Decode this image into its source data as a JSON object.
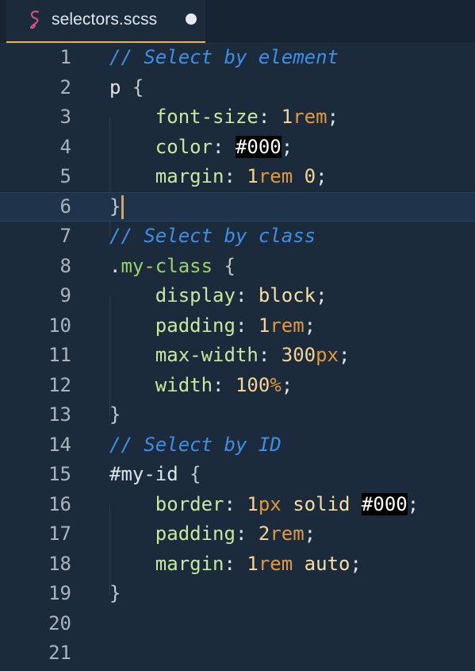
{
  "tab": {
    "filename": "selectors.scss",
    "icon": "sass-icon",
    "modified": true
  },
  "editor": {
    "active_line": 6,
    "lines": [
      {
        "n": "1",
        "tokens": [
          {
            "t": "// Select by element",
            "c": "c-comment"
          }
        ]
      },
      {
        "n": "2",
        "tokens": [
          {
            "t": "p",
            "c": "c-sel"
          },
          {
            "t": " {",
            "c": "c-brace"
          }
        ]
      },
      {
        "n": "3",
        "tokens": [
          {
            "t": "    font-size",
            "c": "c-prop"
          },
          {
            "t": ": ",
            "c": "c-punc"
          },
          {
            "t": "1",
            "c": "c-num"
          },
          {
            "t": "rem",
            "c": "c-unit"
          },
          {
            "t": ";",
            "c": "c-punc"
          }
        ]
      },
      {
        "n": "4",
        "tokens": [
          {
            "t": "    color",
            "c": "c-prop"
          },
          {
            "t": ": ",
            "c": "c-punc"
          },
          {
            "t": "#000",
            "c": "c-hex"
          },
          {
            "t": ";",
            "c": "c-punc"
          }
        ]
      },
      {
        "n": "5",
        "tokens": [
          {
            "t": "    margin",
            "c": "c-prop"
          },
          {
            "t": ": ",
            "c": "c-punc"
          },
          {
            "t": "1",
            "c": "c-num"
          },
          {
            "t": "rem",
            "c": "c-unit"
          },
          {
            "t": " 0",
            "c": "c-num"
          },
          {
            "t": ";",
            "c": "c-punc"
          }
        ]
      },
      {
        "n": "6",
        "tokens": [
          {
            "t": "}",
            "c": "c-brace"
          }
        ]
      },
      {
        "n": "7",
        "tokens": [
          {
            "t": "// Select by class",
            "c": "c-comment"
          }
        ]
      },
      {
        "n": "8",
        "tokens": [
          {
            "t": ".",
            "c": "c-punc"
          },
          {
            "t": "my-class",
            "c": "c-class"
          },
          {
            "t": " {",
            "c": "c-brace"
          }
        ]
      },
      {
        "n": "9",
        "tokens": [
          {
            "t": "    display",
            "c": "c-prop"
          },
          {
            "t": ": ",
            "c": "c-punc"
          },
          {
            "t": "block",
            "c": "c-val"
          },
          {
            "t": ";",
            "c": "c-punc"
          }
        ]
      },
      {
        "n": "10",
        "tokens": [
          {
            "t": "    padding",
            "c": "c-prop"
          },
          {
            "t": ": ",
            "c": "c-punc"
          },
          {
            "t": "1",
            "c": "c-num"
          },
          {
            "t": "rem",
            "c": "c-unit"
          },
          {
            "t": ";",
            "c": "c-punc"
          }
        ]
      },
      {
        "n": "11",
        "tokens": [
          {
            "t": "    max-width",
            "c": "c-prop"
          },
          {
            "t": ": ",
            "c": "c-punc"
          },
          {
            "t": "300",
            "c": "c-num"
          },
          {
            "t": "px",
            "c": "c-unit"
          },
          {
            "t": ";",
            "c": "c-punc"
          }
        ]
      },
      {
        "n": "12",
        "tokens": [
          {
            "t": "    width",
            "c": "c-prop"
          },
          {
            "t": ": ",
            "c": "c-punc"
          },
          {
            "t": "100",
            "c": "c-num"
          },
          {
            "t": "%",
            "c": "c-unit"
          },
          {
            "t": ";",
            "c": "c-punc"
          }
        ]
      },
      {
        "n": "13",
        "tokens": [
          {
            "t": "}",
            "c": "c-brace"
          }
        ]
      },
      {
        "n": "14",
        "tokens": [
          {
            "t": "// Select by ID",
            "c": "c-comment"
          }
        ]
      },
      {
        "n": "15",
        "tokens": [
          {
            "t": "#my-id",
            "c": "c-sel"
          },
          {
            "t": " {",
            "c": "c-brace"
          }
        ]
      },
      {
        "n": "16",
        "tokens": [
          {
            "t": "    border",
            "c": "c-prop"
          },
          {
            "t": ": ",
            "c": "c-punc"
          },
          {
            "t": "1",
            "c": "c-num"
          },
          {
            "t": "px",
            "c": "c-unit"
          },
          {
            "t": " solid ",
            "c": "c-val"
          },
          {
            "t": "#000",
            "c": "c-hex"
          },
          {
            "t": ";",
            "c": "c-punc"
          }
        ]
      },
      {
        "n": "17",
        "tokens": [
          {
            "t": "    padding",
            "c": "c-prop"
          },
          {
            "t": ": ",
            "c": "c-punc"
          },
          {
            "t": "2",
            "c": "c-num"
          },
          {
            "t": "rem",
            "c": "c-unit"
          },
          {
            "t": ";",
            "c": "c-punc"
          }
        ]
      },
      {
        "n": "18",
        "tokens": [
          {
            "t": "    margin",
            "c": "c-prop"
          },
          {
            "t": ": ",
            "c": "c-punc"
          },
          {
            "t": "1",
            "c": "c-num"
          },
          {
            "t": "rem",
            "c": "c-unit"
          },
          {
            "t": " auto",
            "c": "c-val"
          },
          {
            "t": ";",
            "c": "c-punc"
          }
        ]
      },
      {
        "n": "19",
        "tokens": [
          {
            "t": "}",
            "c": "c-brace"
          }
        ]
      },
      {
        "n": "20",
        "tokens": []
      },
      {
        "n": "21",
        "tokens": []
      }
    ]
  },
  "colors": {
    "background": "#1b2b3c",
    "comment": "#3d8fe6",
    "property": "#c8e8a0",
    "number": "#f5d393",
    "unit": "#e19a3b",
    "class_name": "#9ed06b",
    "cursor": "#e6a23c"
  }
}
